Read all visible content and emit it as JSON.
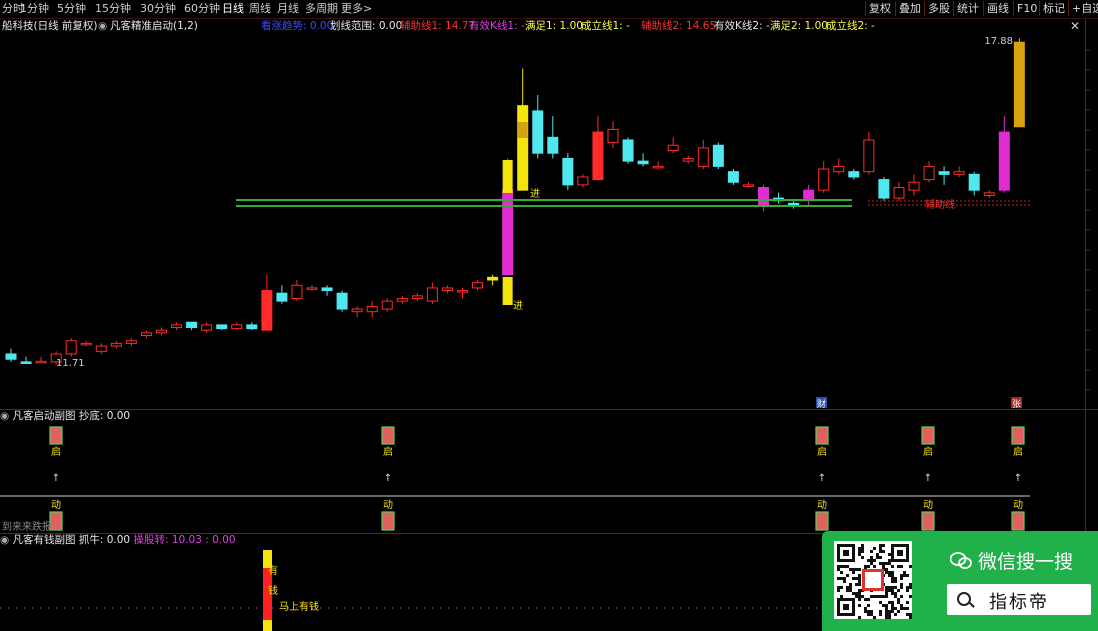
{
  "tabs": [
    "分时",
    "1分钟",
    "5分钟",
    "15分钟",
    "30分钟",
    "60分钟",
    "日线",
    "周线",
    "月线",
    "多周期",
    "更多>"
  ],
  "active_tab": "日线",
  "right_buttons": [
    "复权",
    "叠加",
    "多股",
    "统计",
    "画线",
    "F10",
    "标记",
    "+自选"
  ],
  "title": "船科技(日线 前复权)",
  "indicator_name": "凡客精准启动(1,2)",
  "info": {
    "item1": "看涨趋势: 0.00",
    "item2": "划线范围: 0.00",
    "item3": "辅助线1: 14.77",
    "item4": "有效K线1: -",
    "item5": "满足1: 1.00",
    "item6": "成立线1: -",
    "item7": "辅助线2: 14.65",
    "item8": "有效K线2: -",
    "item9": "满足2: 1.00",
    "item10": "成立线2: -"
  },
  "main_labels": {
    "price_high": "17.88",
    "price_low": "11.71",
    "entry1": "进",
    "entry2": "进",
    "ref_label": "辅助线",
    "badge_cai": "财",
    "badge_zhang": "张"
  },
  "sub1": {
    "name": "凡客启动副图",
    "label": "抄底: 0.00",
    "qi": "启",
    "dong": "动",
    "arrow": "↑",
    "footer": "到来来跌报"
  },
  "sub2": {
    "name": "凡客有钱副图",
    "label1": "抓牛: 0.00",
    "label2": "操股转: 10.03 : 0.00",
    "you": "有",
    "qian": "钱",
    "mashang": "马上有钱"
  },
  "wechat": {
    "title": "微信搜一搜",
    "search": "指标帝"
  },
  "colors": {
    "up": "#ff2b2b",
    "down": "#4fe8f0",
    "magenta": "#e02cd0",
    "yellow": "#f2e40c",
    "gold": "#d6a210",
    "green_line": "#2fae2f",
    "wechat": "#21b14a"
  },
  "chart_data": {
    "type": "candlestick",
    "price_labels_shown": [
      17.88,
      11.71
    ],
    "ohlc_approx": [
      {
        "o": 11.9,
        "h": 12.0,
        "l": 11.75,
        "c": 11.8
      },
      {
        "o": 11.75,
        "h": 11.85,
        "l": 11.71,
        "c": 11.72
      },
      {
        "o": 11.74,
        "h": 11.85,
        "l": 11.72,
        "c": 11.76
      },
      {
        "o": 11.75,
        "h": 11.95,
        "l": 11.7,
        "c": 11.9
      },
      {
        "o": 11.9,
        "h": 12.2,
        "l": 11.85,
        "c": 12.15
      },
      {
        "o": 12.1,
        "h": 12.15,
        "l": 12.05,
        "c": 12.1
      },
      {
        "o": 11.95,
        "h": 12.1,
        "l": 11.9,
        "c": 12.05
      },
      {
        "o": 12.05,
        "h": 12.15,
        "l": 12.0,
        "c": 12.1
      },
      {
        "o": 12.1,
        "h": 12.2,
        "l": 12.05,
        "c": 12.15
      },
      {
        "o": 12.25,
        "h": 12.35,
        "l": 12.2,
        "c": 12.3
      },
      {
        "o": 12.3,
        "h": 12.4,
        "l": 12.25,
        "c": 12.35
      },
      {
        "o": 12.4,
        "h": 12.5,
        "l": 12.35,
        "c": 12.45
      },
      {
        "o": 12.5,
        "h": 12.5,
        "l": 12.35,
        "c": 12.4
      },
      {
        "o": 12.35,
        "h": 12.5,
        "l": 12.3,
        "c": 12.45
      },
      {
        "o": 12.45,
        "h": 12.45,
        "l": 12.35,
        "c": 12.38
      },
      {
        "o": 12.38,
        "h": 12.5,
        "l": 12.35,
        "c": 12.45
      },
      {
        "o": 12.45,
        "h": 12.5,
        "l": 12.35,
        "c": 12.38
      },
      {
        "o": 12.35,
        "h": 13.4,
        "l": 12.35,
        "c": 13.1
      },
      {
        "o": 13.05,
        "h": 13.2,
        "l": 12.85,
        "c": 12.9
      },
      {
        "o": 12.95,
        "h": 13.3,
        "l": 12.9,
        "c": 13.2
      },
      {
        "o": 13.15,
        "h": 13.2,
        "l": 13.1,
        "c": 13.15
      },
      {
        "o": 13.15,
        "h": 13.2,
        "l": 13.0,
        "c": 13.1
      },
      {
        "o": 13.05,
        "h": 13.1,
        "l": 12.7,
        "c": 12.75
      },
      {
        "o": 12.7,
        "h": 12.8,
        "l": 12.6,
        "c": 12.75
      },
      {
        "o": 12.7,
        "h": 12.9,
        "l": 12.6,
        "c": 12.8
      },
      {
        "o": 12.75,
        "h": 12.95,
        "l": 12.7,
        "c": 12.9
      },
      {
        "o": 12.9,
        "h": 13.0,
        "l": 12.85,
        "c": 12.95
      },
      {
        "o": 12.95,
        "h": 13.05,
        "l": 12.9,
        "c": 13.0
      },
      {
        "o": 12.9,
        "h": 13.25,
        "l": 12.85,
        "c": 13.15
      },
      {
        "o": 13.1,
        "h": 13.2,
        "l": 13.05,
        "c": 13.15
      },
      {
        "o": 13.1,
        "h": 13.15,
        "l": 12.95,
        "c": 13.1
      },
      {
        "o": 13.15,
        "h": 13.3,
        "l": 13.1,
        "c": 13.25
      },
      {
        "o": 13.3,
        "h": 13.4,
        "l": 13.2,
        "c": 13.35
      },
      {
        "o": 13.4,
        "h": 15.6,
        "l": 13.4,
        "c": 15.0
      },
      {
        "o": 15.0,
        "h": 17.3,
        "l": 15.0,
        "c": 16.6
      },
      {
        "o": 16.5,
        "h": 16.8,
        "l": 15.6,
        "c": 15.7
      },
      {
        "o": 16.0,
        "h": 16.4,
        "l": 15.6,
        "c": 15.7
      },
      {
        "o": 15.6,
        "h": 15.7,
        "l": 15.0,
        "c": 15.1
      },
      {
        "o": 15.1,
        "h": 15.3,
        "l": 15.05,
        "c": 15.25
      },
      {
        "o": 15.2,
        "h": 16.4,
        "l": 15.2,
        "c": 16.1
      },
      {
        "o": 15.9,
        "h": 16.3,
        "l": 15.8,
        "c": 16.15
      },
      {
        "o": 15.95,
        "h": 16.0,
        "l": 15.5,
        "c": 15.55
      },
      {
        "o": 15.55,
        "h": 15.7,
        "l": 15.45,
        "c": 15.5
      },
      {
        "o": 15.45,
        "h": 15.55,
        "l": 15.4,
        "c": 15.45
      },
      {
        "o": 15.75,
        "h": 16.0,
        "l": 15.7,
        "c": 15.85
      },
      {
        "o": 15.55,
        "h": 15.65,
        "l": 15.5,
        "c": 15.6
      },
      {
        "o": 15.45,
        "h": 15.95,
        "l": 15.4,
        "c": 15.8
      },
      {
        "o": 15.85,
        "h": 15.9,
        "l": 15.4,
        "c": 15.45
      },
      {
        "o": 15.35,
        "h": 15.4,
        "l": 15.1,
        "c": 15.15
      },
      {
        "o": 15.1,
        "h": 15.15,
        "l": 15.05,
        "c": 15.1
      },
      {
        "o": 15.05,
        "h": 15.1,
        "l": 14.6,
        "c": 14.7
      },
      {
        "o": 14.85,
        "h": 14.95,
        "l": 14.75,
        "c": 14.8
      },
      {
        "o": 14.75,
        "h": 14.8,
        "l": 14.65,
        "c": 14.7
      },
      {
        "o": 14.8,
        "h": 15.1,
        "l": 14.7,
        "c": 15.0
      },
      {
        "o": 15.0,
        "h": 15.55,
        "l": 14.95,
        "c": 15.4
      },
      {
        "o": 15.35,
        "h": 15.6,
        "l": 15.3,
        "c": 15.45
      },
      {
        "o": 15.35,
        "h": 15.4,
        "l": 15.2,
        "c": 15.25
      },
      {
        "o": 15.35,
        "h": 16.1,
        "l": 15.3,
        "c": 15.95
      },
      {
        "o": 15.2,
        "h": 15.25,
        "l": 14.8,
        "c": 14.85
      },
      {
        "o": 14.85,
        "h": 15.15,
        "l": 14.8,
        "c": 15.05
      },
      {
        "o": 15.0,
        "h": 15.3,
        "l": 14.9,
        "c": 15.15
      },
      {
        "o": 15.2,
        "h": 15.55,
        "l": 15.15,
        "c": 15.45
      },
      {
        "o": 15.35,
        "h": 15.45,
        "l": 15.1,
        "c": 15.3
      },
      {
        "o": 15.3,
        "h": 15.45,
        "l": 15.25,
        "c": 15.35
      },
      {
        "o": 15.3,
        "h": 15.35,
        "l": 14.9,
        "c": 15.0
      },
      {
        "o": 14.9,
        "h": 15.0,
        "l": 14.85,
        "c": 14.95
      },
      {
        "o": 15.0,
        "h": 16.4,
        "l": 14.95,
        "c": 16.1
      },
      {
        "o": 16.2,
        "h": 17.88,
        "l": 16.2,
        "c": 17.8
      }
    ]
  }
}
